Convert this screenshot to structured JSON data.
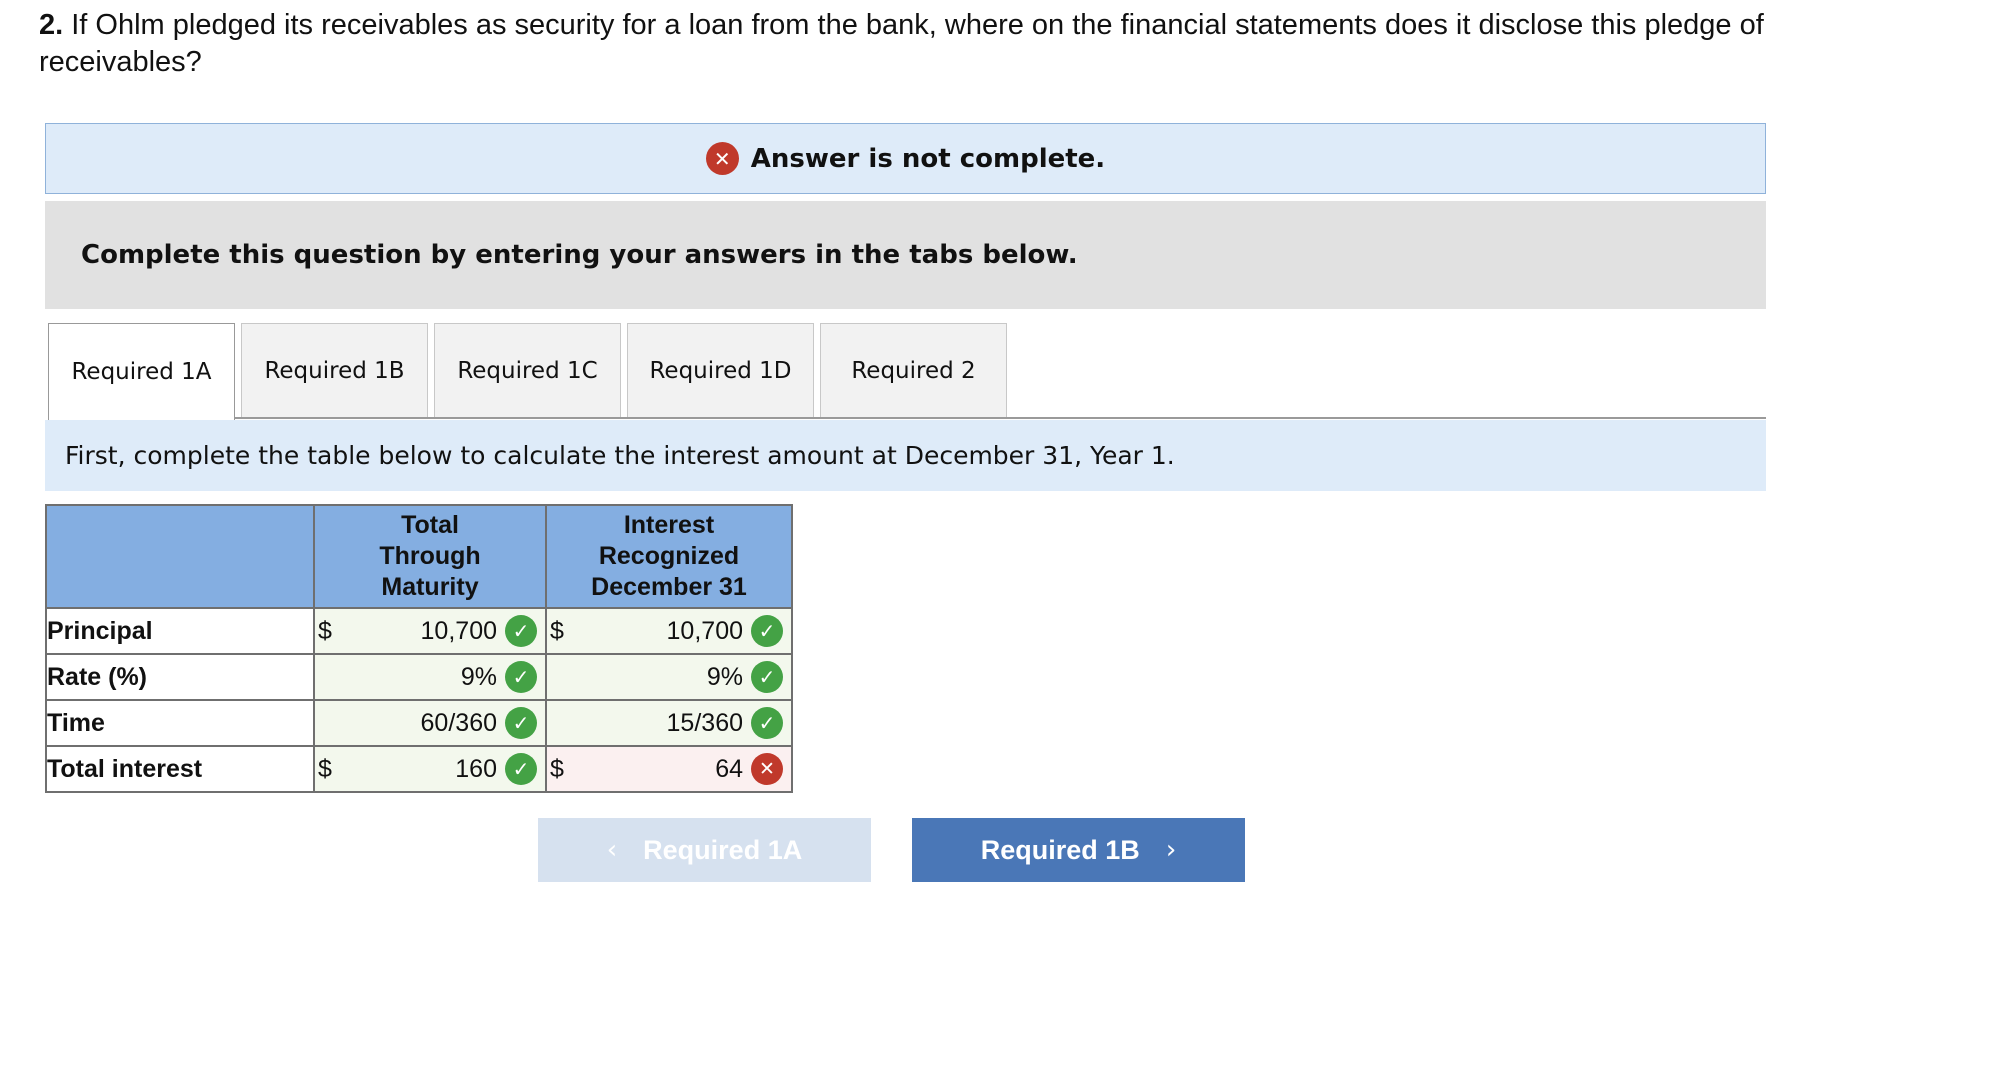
{
  "question": {
    "number": "2.",
    "text": " If Ohlm pledged its receivables as security for a loan from the bank, where on the financial statements does it disclose this pledge of receivables?"
  },
  "banner": {
    "icon": "x-circle-icon",
    "text": "Answer is not complete."
  },
  "instructions": "Complete this question by entering your answers in the tabs below.",
  "tabs": [
    {
      "label": "Required 1A",
      "active": true
    },
    {
      "label": "Required 1B",
      "active": false
    },
    {
      "label": "Required 1C",
      "active": false
    },
    {
      "label": "Required 1D",
      "active": false
    },
    {
      "label": "Required 2",
      "active": false
    }
  ],
  "sub_instructions": "First, complete the table below to calculate the interest amount at December 31, Year 1.",
  "table": {
    "headers": [
      "",
      "Total Through Maturity",
      "Interest Recognized December 31"
    ],
    "rows": [
      {
        "label": "Principal",
        "total": {
          "prefix": "$",
          "value": "10,700",
          "status": "correct"
        },
        "interest": {
          "prefix": "$",
          "value": "10,700",
          "status": "correct"
        }
      },
      {
        "label": "Rate (%)",
        "total": {
          "prefix": "",
          "value": "9%",
          "status": "correct"
        },
        "interest": {
          "prefix": "",
          "value": "9%",
          "status": "correct"
        }
      },
      {
        "label": "Time",
        "total": {
          "prefix": "",
          "value": "60/360",
          "status": "correct"
        },
        "interest": {
          "prefix": "",
          "value": "15/360",
          "status": "correct"
        }
      },
      {
        "label": "Total interest",
        "total": {
          "prefix": "$",
          "value": "160",
          "status": "correct"
        },
        "interest": {
          "prefix": "$",
          "value": "64",
          "status": "incorrect"
        }
      }
    ]
  },
  "nav": {
    "prev_label": "Required 1A",
    "next_label": "Required 1B",
    "prev_icon": "chevron-left-icon",
    "next_icon": "chevron-right-icon"
  },
  "colors": {
    "banner_bg": "#deebf9",
    "header_bg": "#84aee1",
    "correct": "#44a245",
    "incorrect": "#c0392b",
    "next_button": "#4a77b7",
    "prev_button_disabled": "#d6e1ef"
  }
}
